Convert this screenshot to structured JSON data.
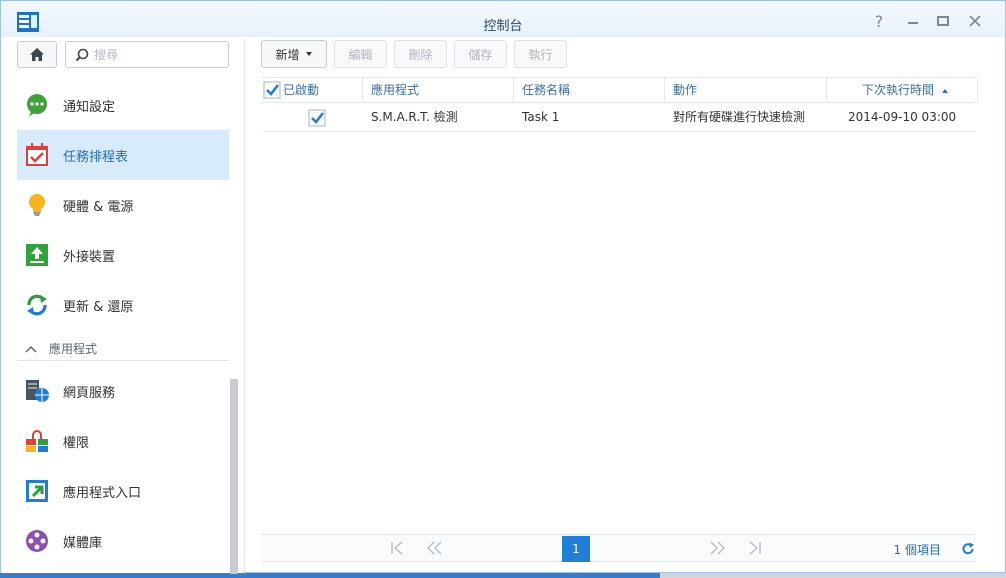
{
  "window": {
    "title": "控制台"
  },
  "search": {
    "placeholder": "搜尋"
  },
  "sidebar": {
    "items": [
      {
        "label": "通知設定"
      },
      {
        "label": "任務排程表"
      },
      {
        "label": "硬體 & 電源"
      },
      {
        "label": "外接裝置"
      },
      {
        "label": "更新 & 還原"
      }
    ],
    "section_label": "應用程式",
    "app_items": [
      {
        "label": "網頁服務"
      },
      {
        "label": "權限"
      },
      {
        "label": "應用程式入口"
      },
      {
        "label": "媒體庫"
      }
    ]
  },
  "toolbar": {
    "create_label": "新增",
    "edit_label": "編輯",
    "delete_label": "刪除",
    "save_label": "儲存",
    "run_label": "執行"
  },
  "grid": {
    "columns": [
      "已啟動",
      "應用程式",
      "任務名稱",
      "動作",
      "下次執行時間"
    ],
    "rows": [
      {
        "enabled": true,
        "app": "S.M.A.R.T. 檢測",
        "task": "Task 1",
        "action": "對所有硬碟進行快速檢測",
        "next_run": "2014-09-10 03:00"
      }
    ]
  },
  "pager": {
    "page": "1",
    "count_label": "1 個項目"
  },
  "colors": {
    "accent": "#1f7fd8",
    "active_bg": "#d8ebfa"
  },
  "icons": [
    "app-icon",
    "home-icon",
    "search-icon",
    "chat-icon",
    "calendar-check-icon",
    "bulb-icon",
    "upload-icon",
    "refresh-arrows-icon",
    "web-service-icon",
    "permission-icon",
    "portal-icon",
    "media-icon",
    "checkbox-icon",
    "sort-asc-icon",
    "refresh-icon"
  ]
}
